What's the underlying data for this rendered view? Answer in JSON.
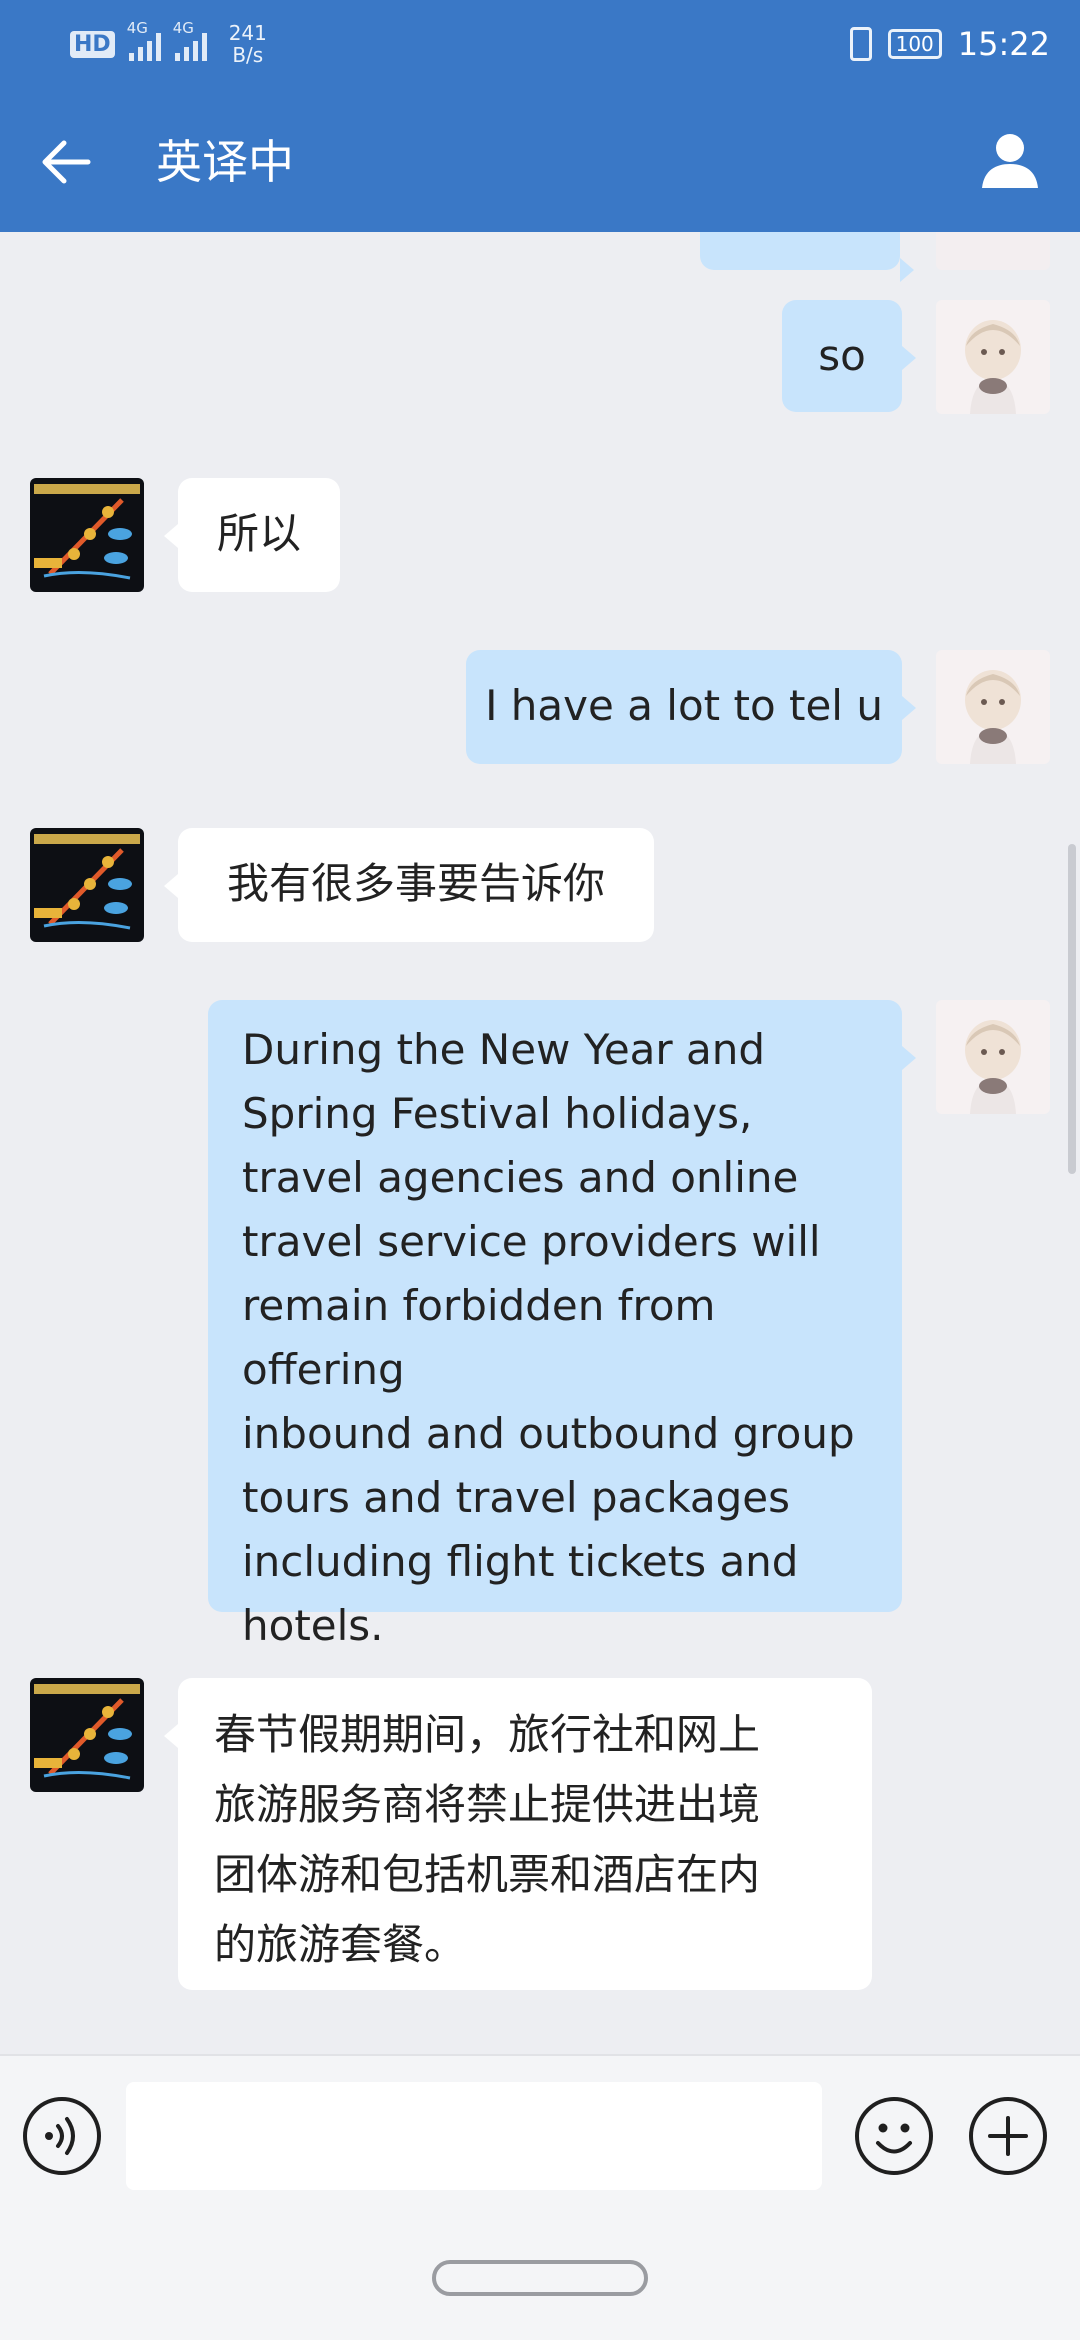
{
  "status_bar": {
    "hd": "HD",
    "network_1": "4G",
    "network_2": "4G",
    "speed_value": "241",
    "speed_unit": "B/s",
    "battery": "100",
    "time": "15:22"
  },
  "header": {
    "title": "英译中"
  },
  "messages": [
    {
      "side": "me",
      "text": "so"
    },
    {
      "side": "them",
      "text": "所以"
    },
    {
      "side": "me",
      "text": "I have a lot to tel u"
    },
    {
      "side": "them",
      "text": "我有很多事要告诉你"
    },
    {
      "side": "me",
      "lines": [
        "During the New Year and",
        "Spring Festival holidays,",
        "travel agencies and online",
        "travel service providers will",
        "remain forbidden from offering",
        "inbound and outbound group",
        "tours and travel packages",
        "including flight tickets and",
        "hotels."
      ]
    },
    {
      "side": "them",
      "lines": [
        "春节假期期间，旅行社和网上",
        "旅游服务商将禁止提供进出境",
        "团体游和包括机票和酒店在内",
        "的旅游套餐。"
      ]
    }
  ],
  "input": {
    "value": ""
  },
  "colors": {
    "header": "#3a78c6",
    "my_bubble": "#c8e4fc",
    "their_bubble": "#ffffff",
    "background": "#edeef2"
  },
  "icons": {
    "back": "arrow-left-icon",
    "user": "person-icon",
    "voice": "voice-icon",
    "emoji": "smiley-icon",
    "plus": "plus-icon"
  }
}
